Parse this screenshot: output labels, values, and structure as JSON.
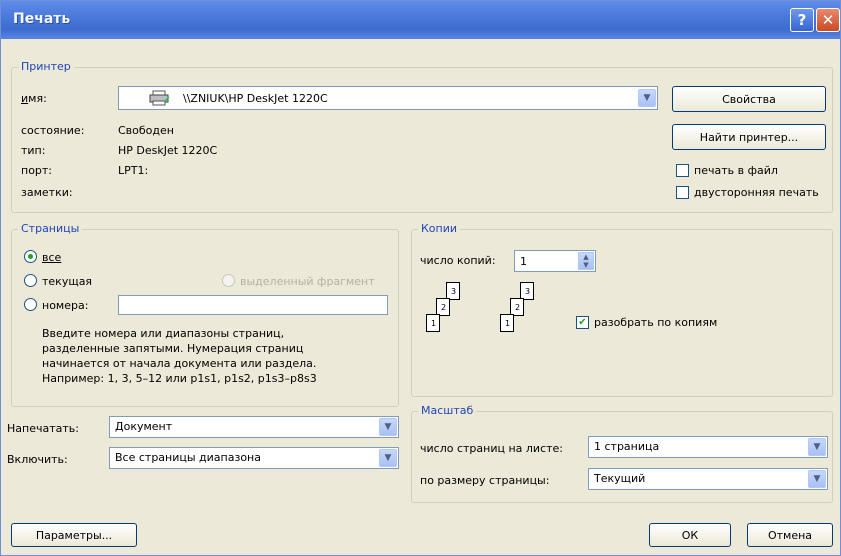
{
  "window": {
    "title": "Печать",
    "help_glyph": "?",
    "close_glyph": "✕"
  },
  "printer": {
    "legend": "Принтер",
    "name_label": "имя:",
    "name_value": "\\\\ZNIUK\\HP DeskJet 1220C",
    "status_label": "состояние:",
    "status_value": "Свободен",
    "type_label": "тип:",
    "type_value": "HP DeskJet 1220C",
    "port_label": "порт:",
    "port_value": "LPT1:",
    "notes_label": "заметки:",
    "properties_button": "Свойства",
    "find_printer_button": "Найти принтер...",
    "print_to_file_label": "печать в файл",
    "print_to_file_checked": false,
    "duplex_label": "двусторонняя печать",
    "duplex_checked": false
  },
  "pages": {
    "legend": "Страницы",
    "all_label": "все",
    "current_label": "текущая",
    "selection_label": "выделенный фрагмент",
    "numbers_label": "номера:",
    "numbers_value": "",
    "selected": "all",
    "help_lines": [
      "Введите номера или диапазоны страниц,",
      "разделенные запятыми. Нумерация страниц",
      "начинается от начала документа или раздела.",
      "Например: 1, 3, 5–12 или p1s1, p1s2, p1s3–p8s3"
    ]
  },
  "copies": {
    "legend": "Копии",
    "count_label": "число копий:",
    "count_value": "1",
    "collate_label": "разобрать по копиям",
    "collate_checked": true,
    "stack_pages": [
      "3",
      "2",
      "1"
    ]
  },
  "print_what": {
    "label": "Напечатать:",
    "value": "Документ"
  },
  "include": {
    "label": "Включить:",
    "value": "Все страницы диапазона"
  },
  "zoom": {
    "legend": "Масштаб",
    "pages_per_sheet_label": "число страниц на листе:",
    "pages_per_sheet_value": "1 страница",
    "scale_to_label": "по размеру страницы:",
    "scale_to_value": "Текущий"
  },
  "footer": {
    "options_button": "Параметры...",
    "ok_button": "ОК",
    "cancel_button": "Отмена"
  },
  "colors": {
    "titlebar": "#3e6bd0",
    "group_legend": "#1e45b8",
    "dialog_bg": "#ece9d8",
    "check_mark": "#21a121"
  }
}
